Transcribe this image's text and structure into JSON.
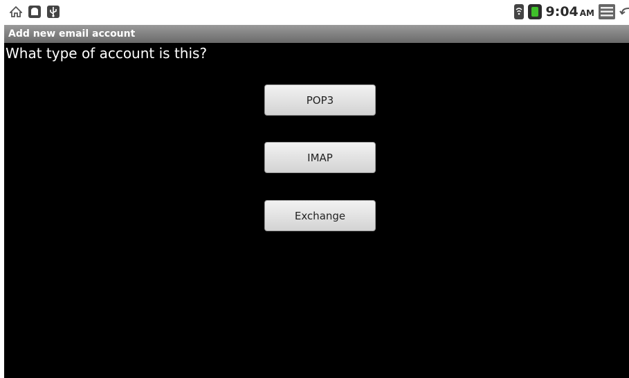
{
  "status_bar": {
    "left_icons": [
      "home-icon",
      "android-debug-icon",
      "usb-icon"
    ],
    "right_icons": [
      "wifi-signal-icon",
      "battery-icon",
      "menu-icon",
      "back-icon"
    ],
    "time": "9:04",
    "ampm": "AM",
    "colors": {
      "battery": "#3fbf2a"
    }
  },
  "title_bar": {
    "title": "Add new email account"
  },
  "main": {
    "question": "What type of account is this?",
    "buttons": [
      {
        "label": "POP3"
      },
      {
        "label": "IMAP"
      },
      {
        "label": "Exchange"
      }
    ]
  }
}
